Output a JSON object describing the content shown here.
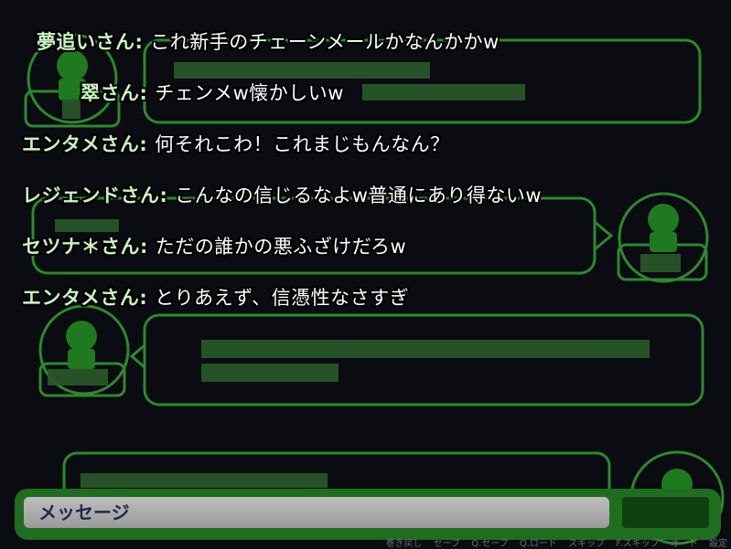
{
  "chat": [
    {
      "speaker": "夢追いさん",
      "text": "これ新手のチェーンメールかなんかかw"
    },
    {
      "speaker": "翠さん",
      "text": "チェンメw懐かしいw"
    },
    {
      "speaker": "エンタメさん",
      "text": "何それこわ！これまじもんなん？"
    },
    {
      "speaker": "レジェンドさん",
      "text": "こんなの信じるなよw普通にあり得ないw"
    },
    {
      "speaker": "セツナ＊さん",
      "text": "ただの誰かの悪ふざけだろw"
    },
    {
      "speaker": "エンタメさん",
      "text": "とりあえず、信憑性なさすぎ"
    }
  ],
  "message_bar": {
    "placeholder": "メッセージ"
  },
  "menu": {
    "rollback": "巻き戻し",
    "save": "セーブ",
    "qsave": "Q.セーブ",
    "qload": "Q.ロード",
    "skip": "スキップ",
    "fskip": "F.スキップ",
    "auto": "オート",
    "config": "設定"
  },
  "colors": {
    "accent": "#1f6e1f",
    "bg": "#0b0b12",
    "speaker": "#c8f5c0"
  }
}
